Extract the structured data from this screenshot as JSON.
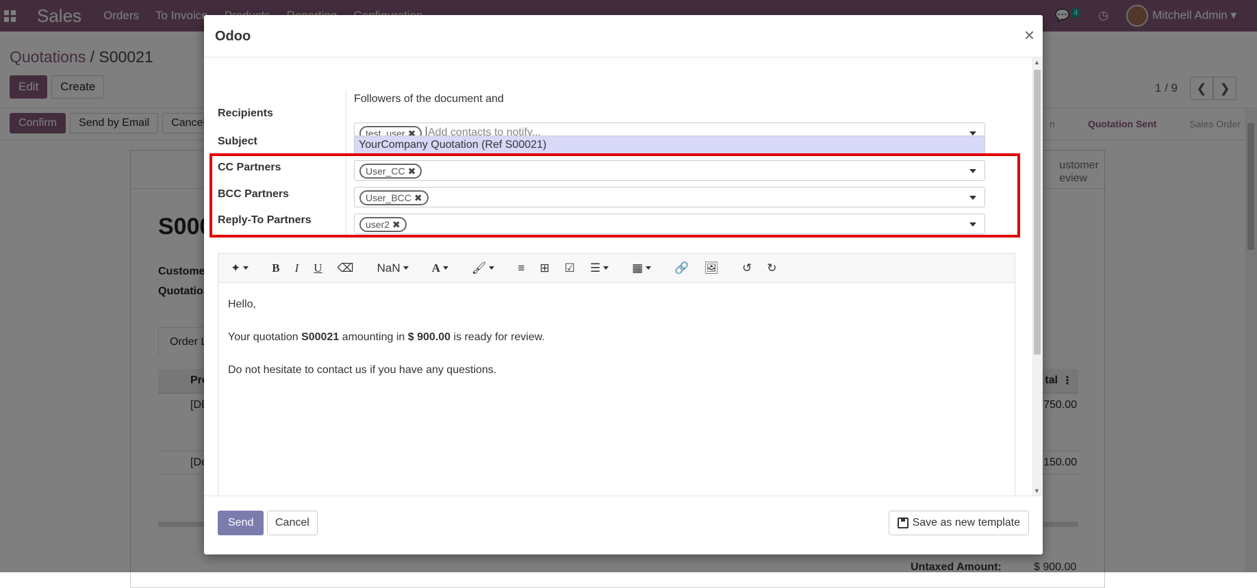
{
  "navbar": {
    "brand": "Sales",
    "menu": [
      "Orders",
      "To Invoice",
      "Products",
      "Reporting",
      "Configuration"
    ],
    "chat_count": "4",
    "user_name": "Mitchell Admin"
  },
  "control_panel": {
    "breadcrumb_parent": "Quotations",
    "breadcrumb_sep": " / ",
    "breadcrumb_current": "S00021",
    "edit_label": "Edit",
    "create_label": "Create",
    "pager": "1 / 9",
    "prev_icon": "chevron-left-icon",
    "next_icon": "chevron-right-icon"
  },
  "statusbar": {
    "confirm_label": "Confirm",
    "send_email_label": "Send by Email",
    "cancel_label": "Cancel",
    "stages": [
      "n",
      "Quotation Sent",
      "Sales Order"
    ],
    "active_stage": "Quotation Sent"
  },
  "sheet": {
    "customer_tab_line1": "ustomer",
    "customer_tab_line2": "eview",
    "order_name": "S000",
    "customer_label": "Custome",
    "quotation_label": "Quotation",
    "order_lines_tab": "Order L",
    "col_product": "Pro",
    "col_total": "tal",
    "row1": "[DE",
    "row1_total": "750.00",
    "row2": "[De",
    "row2_total": "150.00",
    "untaxed_label": "Untaxed Amount:",
    "untaxed_value": "$ 900.00"
  },
  "modal": {
    "title": "Odoo",
    "close_glyph": "×",
    "recipients_label": "Recipients",
    "followers_text": "Followers of the document and",
    "recipient_tag": "test_user",
    "recipients_placeholder": "Add contacts to notify...",
    "subject_label": "Subject",
    "subject_value": "YourCompany Quotation (Ref S00021)",
    "cc_label": "CC Partners",
    "cc_tag": "User_CC",
    "bcc_label": "BCC Partners",
    "bcc_tag": "User_BCC",
    "replyto_label": "Reply-To Partners",
    "replyto_tag": "user2",
    "font_size": "NaN",
    "body_greeting": "Hello,",
    "body_line1_a": "Your quotation ",
    "body_line1_b": "S00021",
    "body_line1_c": " amounting in ",
    "body_line1_d": "$ 900.00",
    "body_line1_e": " is ready for review.",
    "body_line2": "Do not hesitate to contact us if you have any questions.",
    "send_label": "Send",
    "cancel_label": "Cancel",
    "save_template_label": "Save as new template",
    "highlight_color": "#e00000"
  }
}
